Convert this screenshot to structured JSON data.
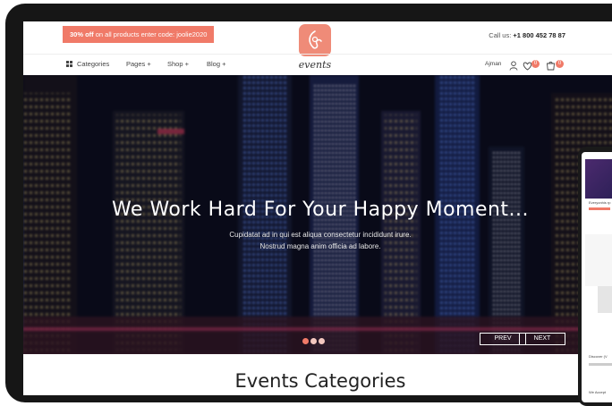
{
  "promo": {
    "highlight": "30% off",
    "text": " on all products enter code: joolie2020"
  },
  "brand": {
    "logo_text": "events"
  },
  "contact": {
    "label": "Call us:",
    "phone": "+1 800 452 78 87"
  },
  "nav": {
    "categories": "Categories",
    "items": [
      {
        "label": "Pages +"
      },
      {
        "label": "Shop +"
      },
      {
        "label": "Blog +"
      }
    ]
  },
  "user": {
    "name": "Ajman",
    "wishlist_count": "0",
    "cart_count": "0"
  },
  "hero": {
    "title": "We Work Hard For Your Happy Moment...",
    "subtitle_line1": "Cupidatat ad in qui est aliqua consectetur incididunt irure.",
    "subtitle_line2": "Nostrud magna anim officia ad labore.",
    "prev_label": "PREV",
    "next_label": "NEXT",
    "slides": 3,
    "active_slide": 1
  },
  "section": {
    "title": "Events Categories"
  },
  "phone_preview": {
    "line1": "Everyonhis rp",
    "line2": "Discover (V",
    "line3": "We Accept"
  },
  "colors": {
    "accent": "#f07a68",
    "logo_bg": "#ef8b78",
    "device": "#161616"
  }
}
